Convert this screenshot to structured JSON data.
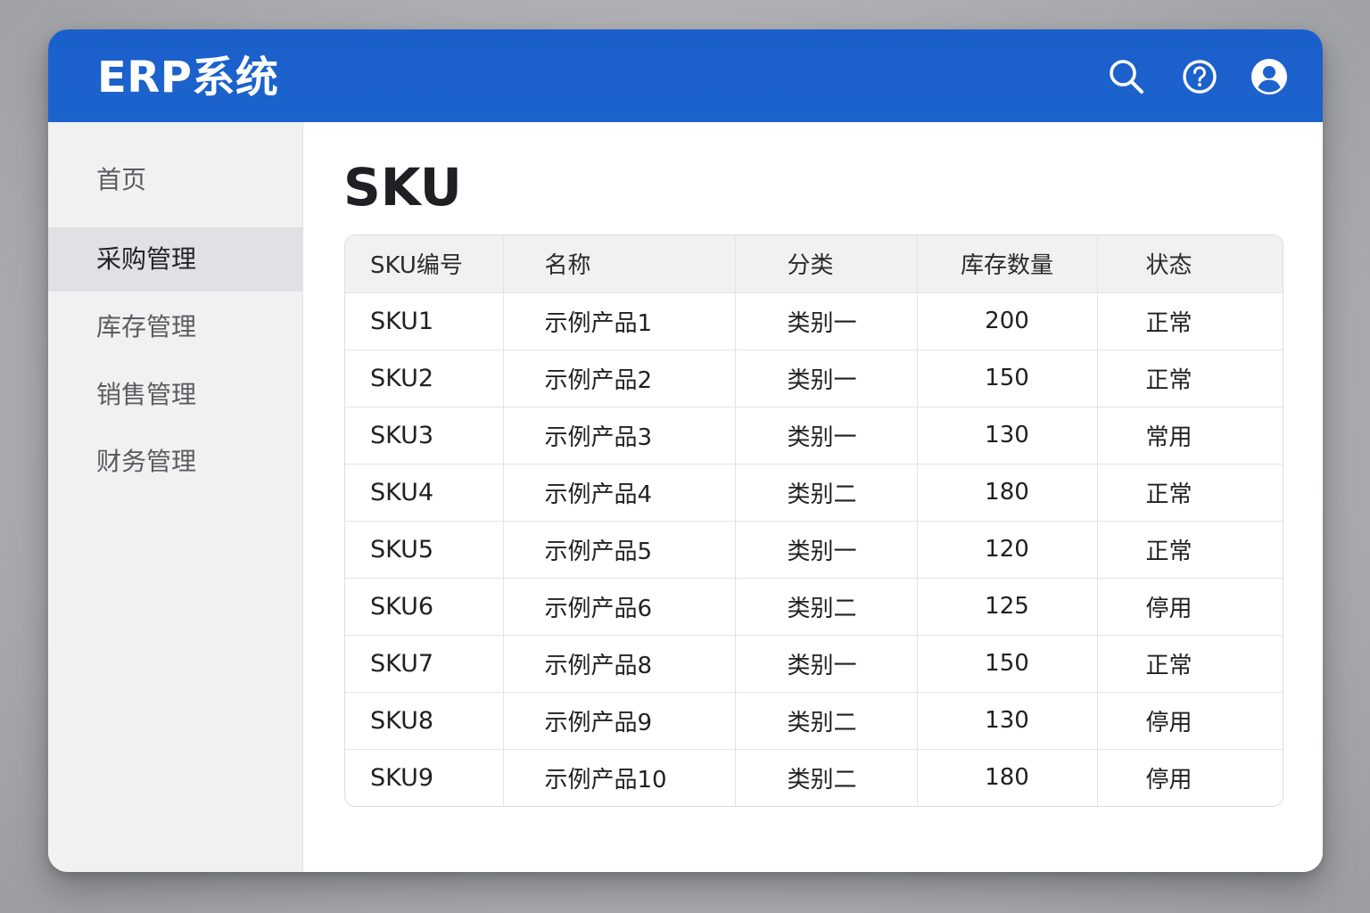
{
  "app": {
    "title": "ERP系统"
  },
  "header": {
    "icons": [
      "search-icon",
      "help-icon",
      "user-avatar-icon"
    ]
  },
  "sidebar": {
    "items": [
      {
        "label": "首页",
        "active": false
      },
      {
        "label": "采购管理",
        "active": true
      },
      {
        "label": "库存管理",
        "active": false
      },
      {
        "label": "销售管理",
        "active": false
      },
      {
        "label": "财务管理",
        "active": false
      }
    ]
  },
  "main": {
    "title": "SKU",
    "table": {
      "headers": [
        "SKU编号",
        "名称",
        "分类",
        "库存数量",
        "状态"
      ],
      "rows": [
        [
          "SKU1",
          "示例产品1",
          "类别一",
          "200",
          "正常"
        ],
        [
          "SKU2",
          "示例产品2",
          "类别一",
          "150",
          "正常"
        ],
        [
          "SKU3",
          "示例产品3",
          "类别一",
          "130",
          "常用"
        ],
        [
          "SKU4",
          "示例产品4",
          "类别二",
          "180",
          "正常"
        ],
        [
          "SKU5",
          "示例产品5",
          "类别一",
          "120",
          "正常"
        ],
        [
          "SKU6",
          "示例产品6",
          "类别二",
          "125",
          "停用"
        ],
        [
          "SKU7",
          "示例产品8",
          "类别一",
          "150",
          "正常"
        ],
        [
          "SKU8",
          "示例产品9",
          "类别二",
          "130",
          "停用"
        ],
        [
          "SKU9",
          "示例产品10",
          "类别二",
          "180",
          "停用"
        ]
      ]
    }
  },
  "colors": {
    "header": "#1d63cc",
    "sidebar": "#f1f1f2",
    "active_item": "#dfe1e4"
  }
}
